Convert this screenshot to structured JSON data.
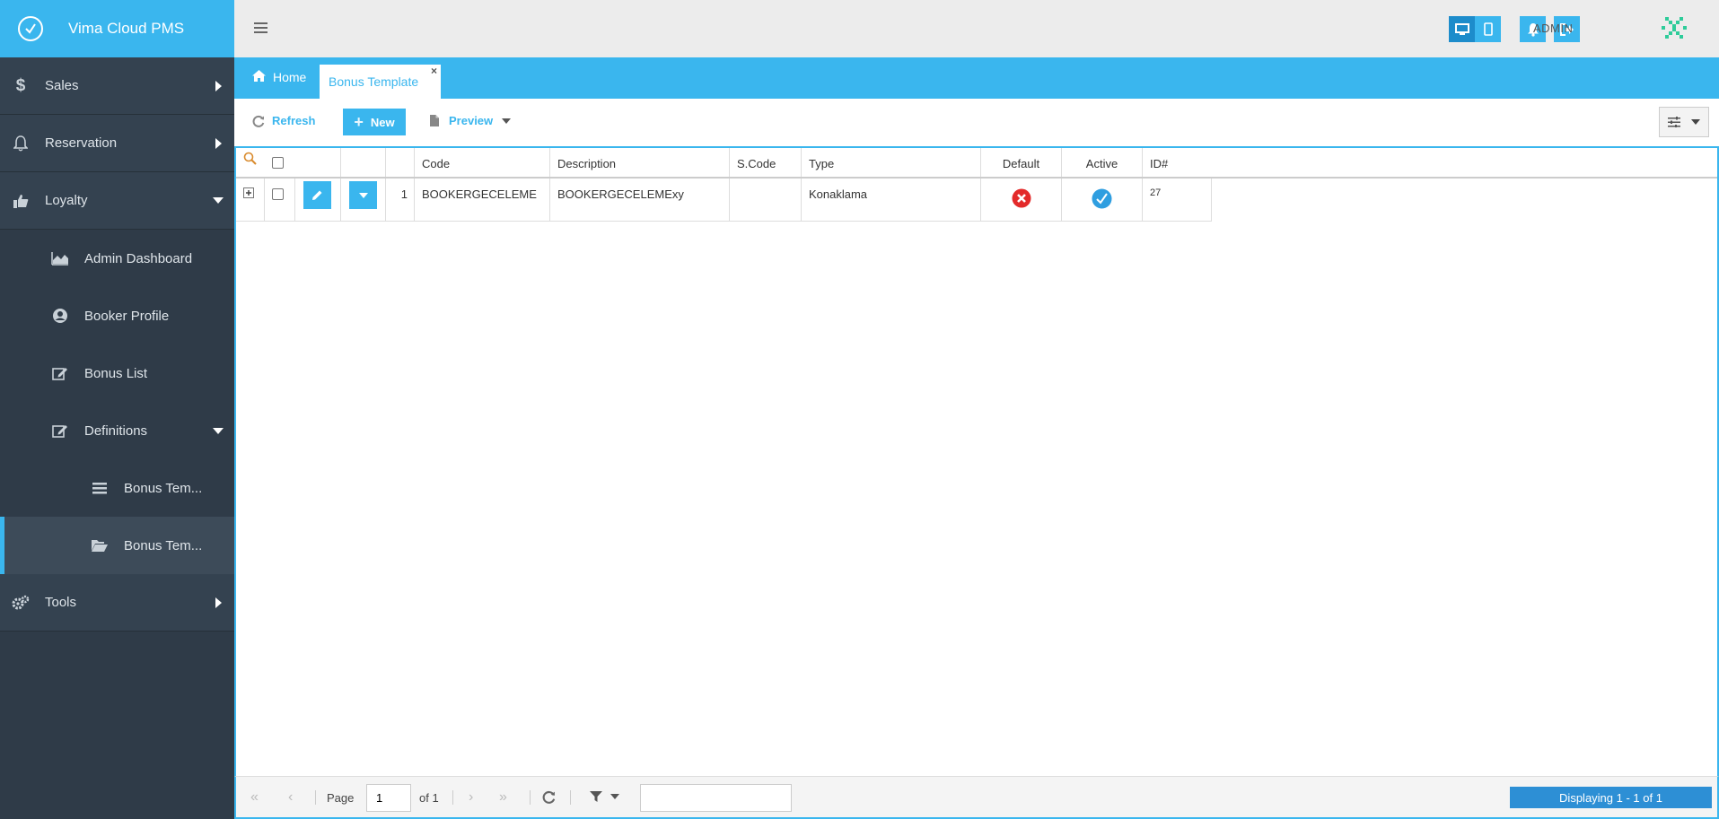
{
  "app": {
    "title": "Vima Cloud PMS"
  },
  "sidebar": {
    "items": [
      {
        "label": "Sales",
        "icon": "dollar-icon"
      },
      {
        "label": "Reservation",
        "icon": "bell-icon"
      },
      {
        "label": "Loyalty",
        "icon": "thumbs-up-icon"
      },
      {
        "label": "Admin Dashboard",
        "icon": "area-chart-icon"
      },
      {
        "label": "Booker Profile",
        "icon": "user-circle-icon"
      },
      {
        "label": "Bonus List",
        "icon": "edit-icon"
      },
      {
        "label": "Definitions",
        "icon": "edit-icon"
      },
      {
        "label": "Bonus Tem...",
        "icon": "list-icon"
      },
      {
        "label": "Bonus Tem...",
        "icon": "folder-open-icon"
      },
      {
        "label": "Tools",
        "icon": "gears-icon"
      }
    ]
  },
  "topbar": {
    "user": "ADMIN"
  },
  "tabs": {
    "home": "Home",
    "active": "Bonus Template",
    "close": "×"
  },
  "toolbar": {
    "refresh": "Refresh",
    "new": "New",
    "preview": "Preview"
  },
  "grid": {
    "columns": [
      "Code",
      "Description",
      "S.Code",
      "Type",
      "Default",
      "Active",
      "ID#"
    ],
    "rows": [
      {
        "num": "1",
        "code": "BOOKERGECELEME",
        "description": "BOOKERGECELEMExy",
        "scode": "",
        "type": "Konaklama",
        "default": false,
        "active": true,
        "id": "27"
      }
    ]
  },
  "pager": {
    "page_label": "Page",
    "page_value": "1",
    "of_label": "of 1",
    "display": "Displaying 1 - 1 of 1"
  },
  "colors": {
    "accent": "#3ab6ee",
    "sidebar": "#2f3b48",
    "error": "#e32a2a"
  }
}
